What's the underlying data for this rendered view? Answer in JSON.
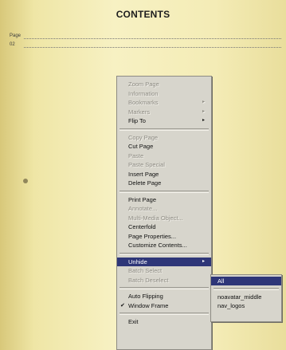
{
  "page": {
    "title": "CONTENTS",
    "toc_label_1": "Page",
    "toc_label_2": "02"
  },
  "context_menu": {
    "items": [
      {
        "label": "Zoom Page",
        "enabled": false
      },
      {
        "label": "Information",
        "enabled": false
      },
      {
        "label": "Bookmarks",
        "enabled": false,
        "submenu": true
      },
      {
        "label": "Markers",
        "enabled": false,
        "submenu": true
      },
      {
        "label": "Flip To",
        "enabled": true,
        "submenu": true
      },
      {
        "label": "Copy Page",
        "enabled": false
      },
      {
        "label": "Cut Page",
        "enabled": true
      },
      {
        "label": "Paste",
        "enabled": false
      },
      {
        "label": "Paste Special",
        "enabled": false
      },
      {
        "label": "Insert Page",
        "enabled": true
      },
      {
        "label": "Delete Page",
        "enabled": true
      },
      {
        "label": "Print Page",
        "enabled": true
      },
      {
        "label": "Annotate...",
        "enabled": false
      },
      {
        "label": "Multi-Media Object...",
        "enabled": false
      },
      {
        "label": "Centerfold",
        "enabled": true
      },
      {
        "label": "Page Properties...",
        "enabled": true
      },
      {
        "label": "Customize Contents...",
        "enabled": true
      },
      {
        "label": "Unhide",
        "enabled": true,
        "submenu": true,
        "highlighted": true
      },
      {
        "label": "Batch Select",
        "enabled": false
      },
      {
        "label": "Batch Deselect",
        "enabled": false
      },
      {
        "label": "Auto Flipping",
        "enabled": true
      },
      {
        "label": "Window Frame",
        "enabled": true,
        "checked": true
      },
      {
        "label": "Exit",
        "enabled": true
      }
    ]
  },
  "unhide_submenu": {
    "items": [
      {
        "label": "All",
        "highlighted": true
      },
      {
        "label": "noavatar_middle"
      },
      {
        "label": "nav_logos"
      }
    ]
  },
  "symbols": {
    "arrow": "▸",
    "check": "✔"
  }
}
